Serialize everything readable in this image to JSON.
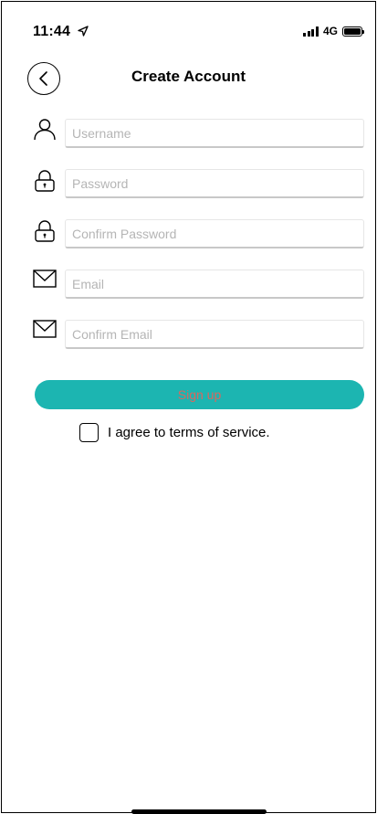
{
  "status_bar": {
    "time": "11:44",
    "network": "4G",
    "icons": [
      "location-arrow-icon",
      "signal-icon",
      "battery-icon"
    ]
  },
  "nav": {
    "title": "Create Account",
    "back_icon": "chevron-left-icon"
  },
  "form": {
    "fields": [
      {
        "placeholder": "Username",
        "value": "",
        "icon": "user-icon"
      },
      {
        "placeholder": "Password",
        "value": "",
        "icon": "lock-icon"
      },
      {
        "placeholder": "Confirm Password",
        "value": "",
        "icon": "lock-icon"
      },
      {
        "placeholder": "Email",
        "value": "",
        "icon": "envelope-icon"
      },
      {
        "placeholder": "Confirm Email",
        "value": "",
        "icon": "envelope-icon"
      }
    ],
    "signup_label": "Sign up",
    "terms_label": "I agree to terms of service.",
    "terms_checked": false
  },
  "colors": {
    "accent": "#1cb5b1",
    "signup_text": "#d9675f",
    "placeholder": "#b5b5b5",
    "field_border": "#c8c8c8"
  }
}
